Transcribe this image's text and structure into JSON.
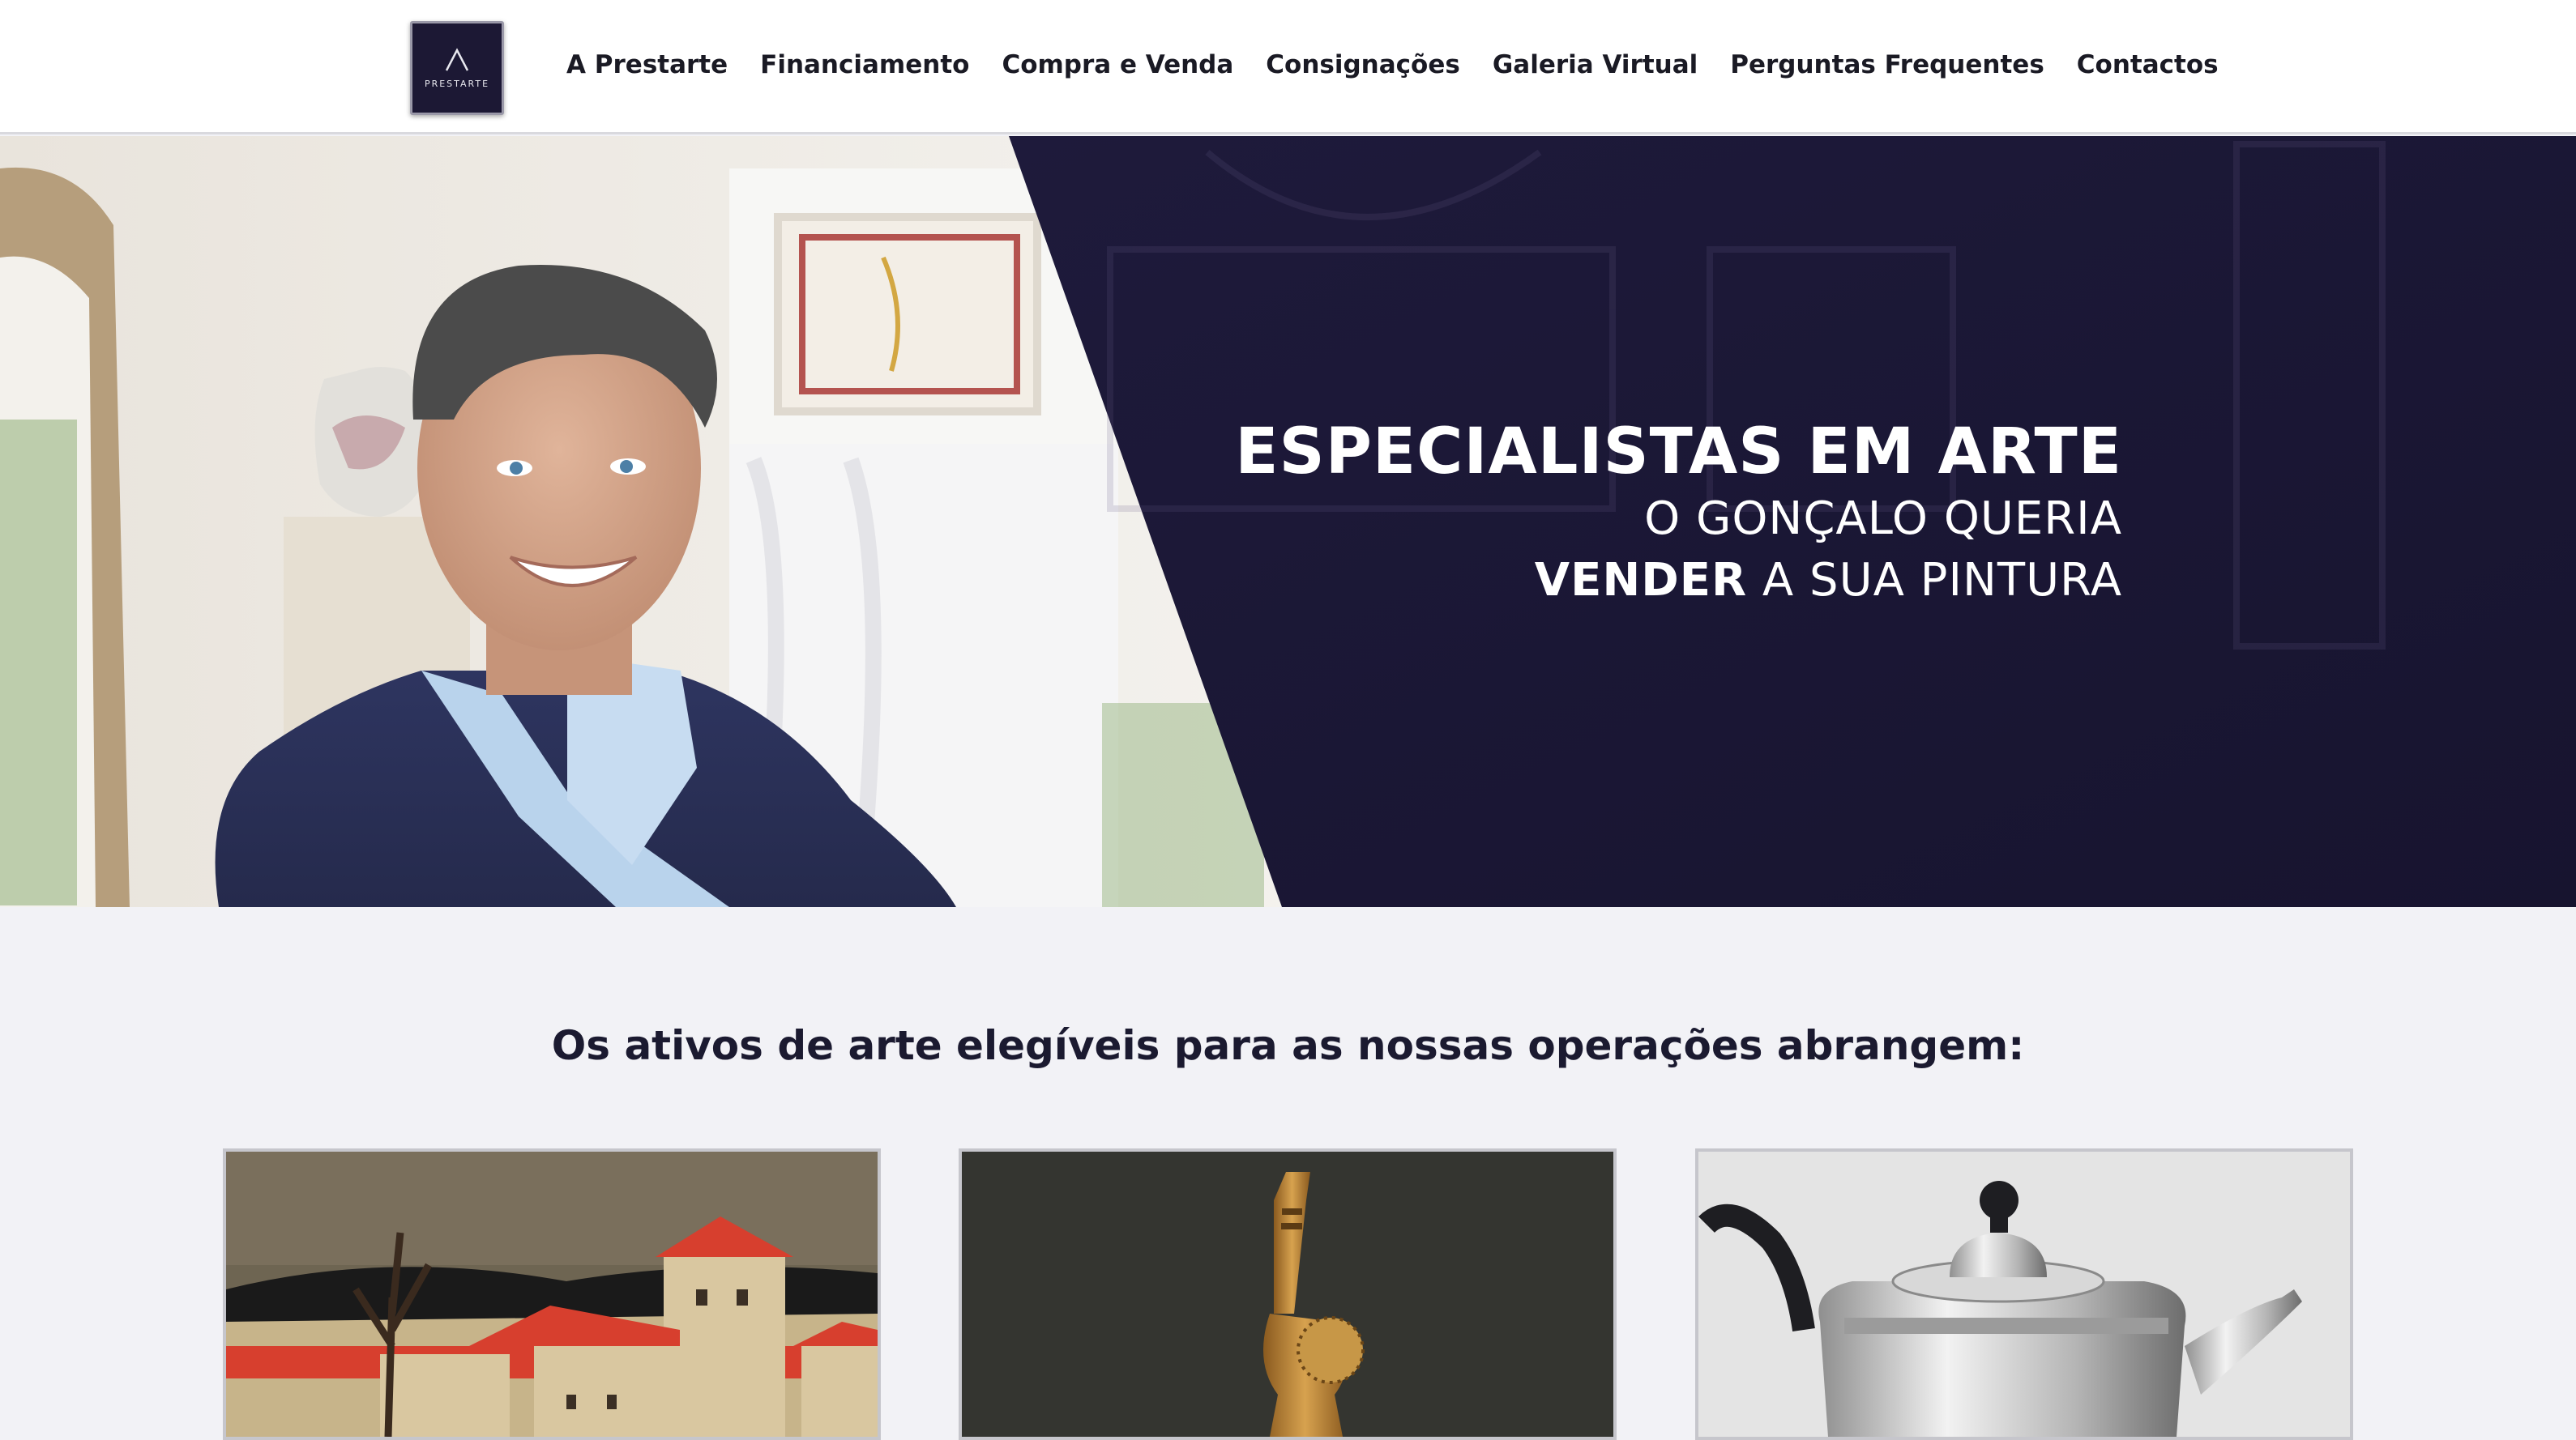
{
  "header": {
    "logo": {
      "text": "PRESTARTE",
      "icon": "prestarte-a-logo-icon"
    },
    "nav": [
      {
        "label": "A Prestarte"
      },
      {
        "label": "Financiamento"
      },
      {
        "label": "Compra e Venda"
      },
      {
        "label": "Consignações"
      },
      {
        "label": "Galeria Virtual"
      },
      {
        "label": "Perguntas Frequentes"
      },
      {
        "label": "Contactos"
      }
    ]
  },
  "hero": {
    "title": "ESPECIALISTAS EM ARTE",
    "line1": "O GONÇALO QUERIA",
    "line2_bold": "VENDER",
    "line2_rest": " A SUA PINTURA",
    "photo": "smiling-man-photo"
  },
  "assets": {
    "heading": "Os ativos de arte elegíveis para as nossas operações abrangem:",
    "cards": [
      {
        "image": "painting-image"
      },
      {
        "image": "sculpture-image"
      },
      {
        "image": "silver-teapot-image"
      }
    ]
  },
  "colors": {
    "brand_navy": "#1c1834",
    "hero_panel": "#1b1736",
    "nav_text": "#1a1a24",
    "page_bg": "#f2f2f6"
  }
}
